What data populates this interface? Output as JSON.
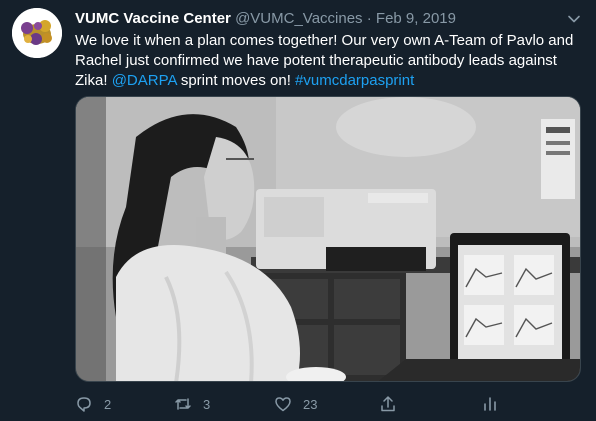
{
  "tweet": {
    "author_name": "VUMC Vaccine Center",
    "handle": "@VUMC_Vaccines",
    "separator": "·",
    "date": "Feb 9, 2019",
    "text_before_mention": "We love it when a plan comes together!  Our very own A-Team of Pavlo and Rachel just confirmed we have potent therapeutic antibody leads against Zika!  ",
    "mention": "@DARPA",
    "text_between": " sprint moves on! ",
    "hashtag": "#vumcdarpasprint"
  },
  "actions": {
    "reply_icon": "reply-icon",
    "reply_count": "2",
    "retweet_icon": "retweet-icon",
    "retweet_count": "3",
    "like_icon": "heart-icon",
    "like_count": "23",
    "share_icon": "share-icon",
    "analytics_icon": "analytics-icon"
  },
  "colors": {
    "background": "#15202b",
    "secondary_text": "#8899a6",
    "link": "#1da1f2"
  }
}
